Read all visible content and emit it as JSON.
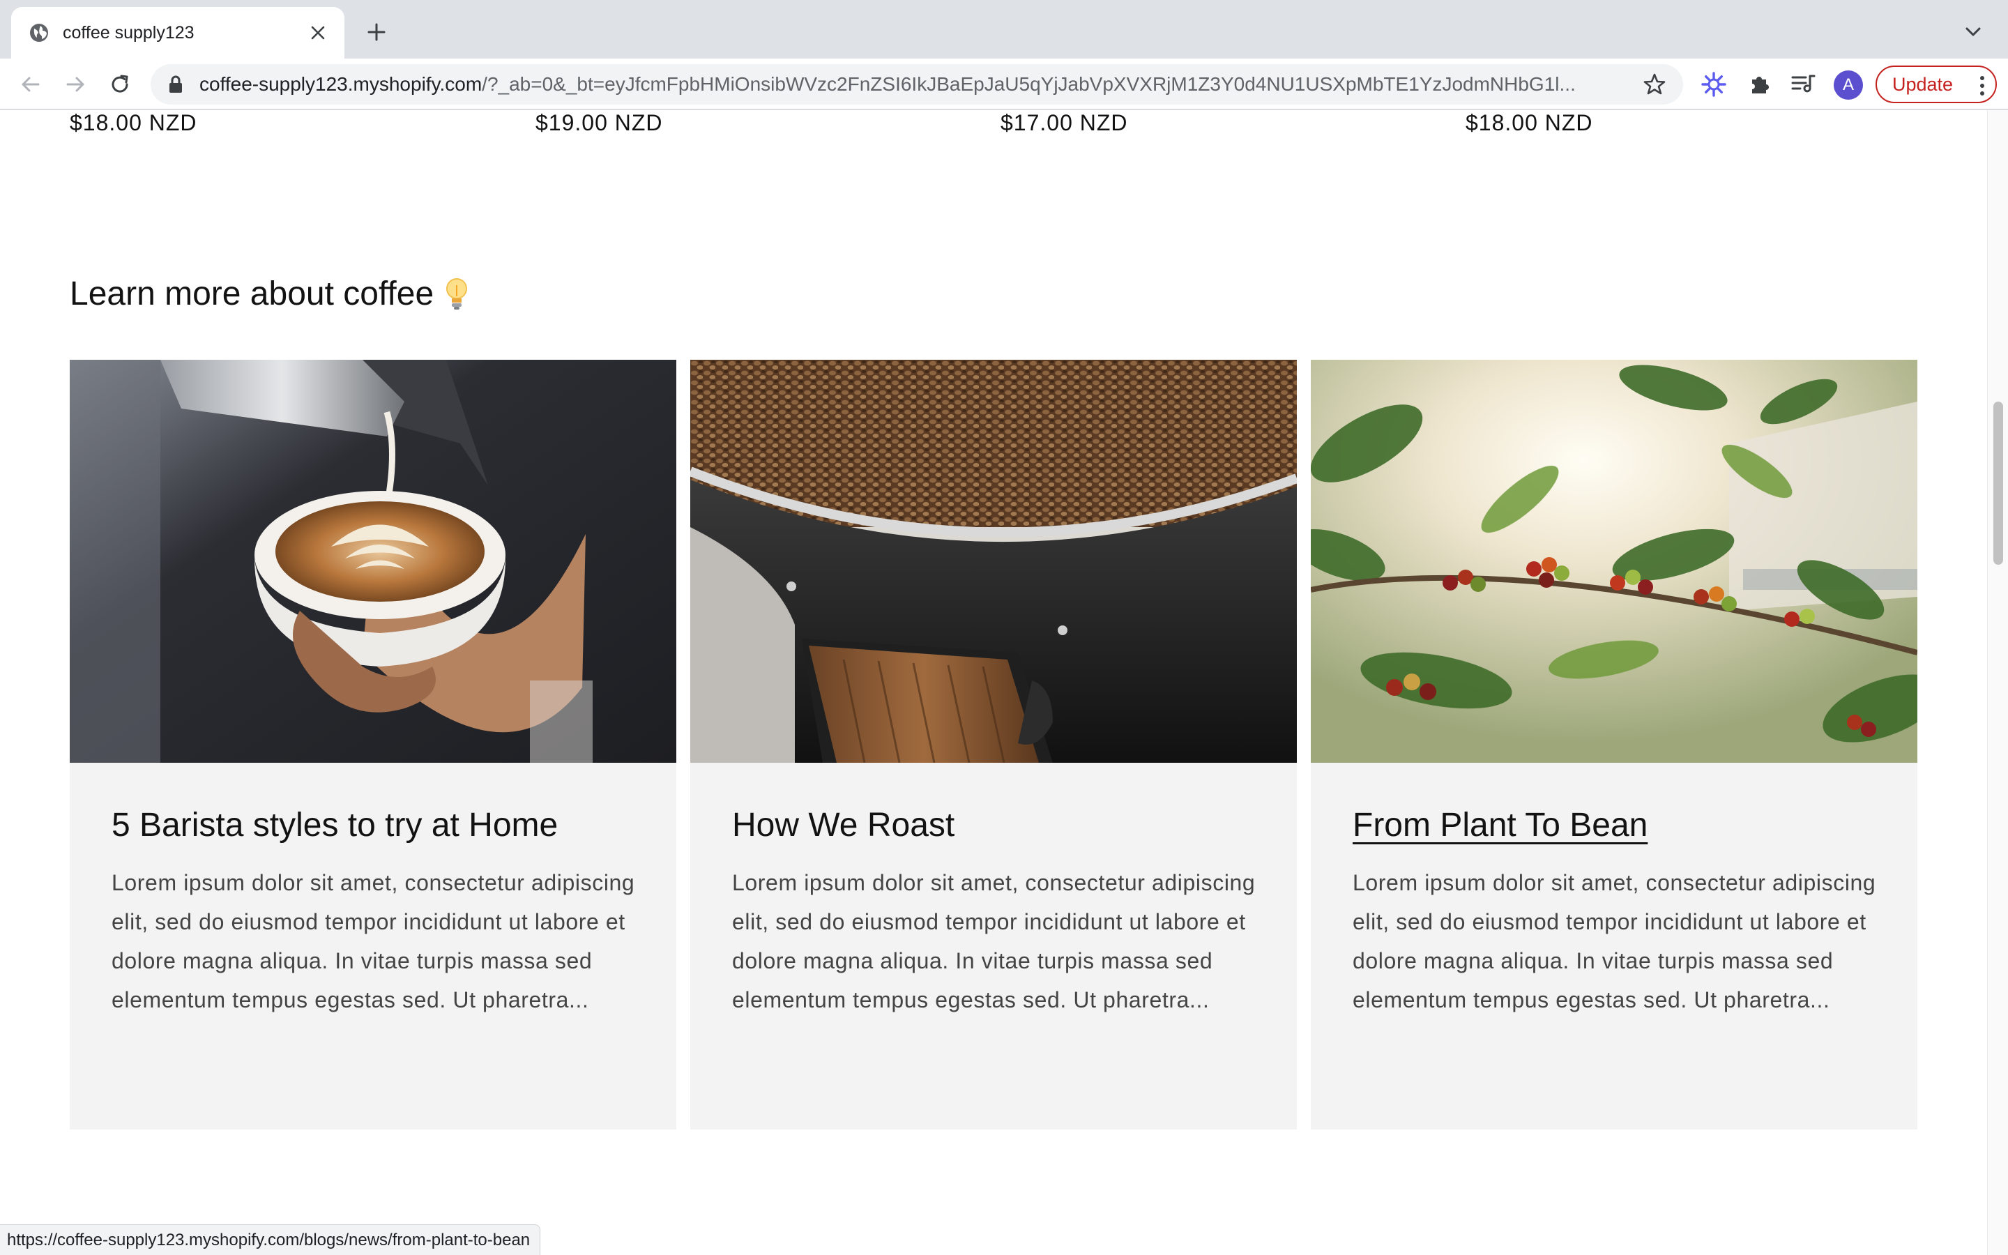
{
  "browser": {
    "tab_title": "coffee supply123",
    "url_host": "coffee-supply123.myshopify.com",
    "url_rest": "/?_ab=0&_bt=eyJfcmFpbHMiOnsibWVzc2FnZSI6IkJBaEpJaU5qYjJabVpXVXRjM1Z3Y0d4NU1USXpMbTE1YzJodmNHbG1l...",
    "avatar_letter": "A",
    "update_label": "Update",
    "status_url": "https://coffee-supply123.myshopify.com/blogs/news/from-plant-to-bean"
  },
  "products": {
    "prices": [
      "$18.00 NZD",
      "$19.00 NZD",
      "$17.00 NZD",
      "$18.00 NZD"
    ]
  },
  "blog": {
    "section_title": "Learn more about coffee",
    "articles": [
      {
        "title": "5 Barista styles to try at Home",
        "excerpt": "Lorem ipsum dolor sit amet, consectetur adipiscing elit, sed do eiusmod tempor incididunt ut labore et dolore magna aliqua. In vitae turpis massa sed elementum tempus egestas sed. Ut pharetra...",
        "image": "latte-art-photo"
      },
      {
        "title": "How We Roast",
        "excerpt": "Lorem ipsum dolor sit amet, consectetur adipiscing elit, sed do eiusmod tempor incididunt ut labore et dolore magna aliqua. In vitae turpis massa sed elementum tempus egestas sed. Ut pharetra...",
        "image": "coffee-roaster-photo"
      },
      {
        "title": "From Plant To Bean",
        "excerpt": "Lorem ipsum dolor sit amet, consectetur adipiscing elit, sed do eiusmod tempor incididunt ut labore et dolore magna aliqua. In vitae turpis massa sed elementum tempus egestas sed. Ut pharetra...",
        "image": "coffee-cherries-photo",
        "hovered": true
      }
    ]
  },
  "colors": {
    "update_red": "#c5221f",
    "card_bg": "#f3f3f3",
    "text": "#121212",
    "muted_text": "#444444"
  }
}
